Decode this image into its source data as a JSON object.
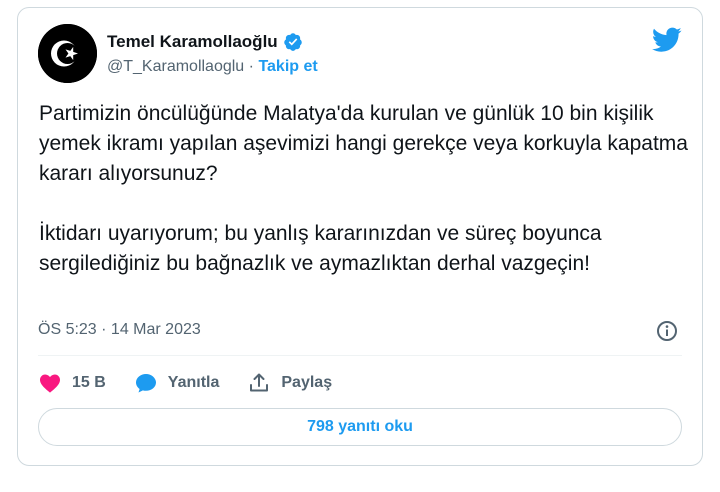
{
  "author": {
    "name": "Temel Karamollaoğlu",
    "handle": "@T_Karamollaoglu",
    "separator": "·",
    "follow_label": "Takip et",
    "avatar_icon": "crescent-star-icon",
    "verified_icon": "verified-badge-icon"
  },
  "tweet": {
    "text": "Partimizin öncülüğünde Malatya'da kurulan ve günlük 10 bin kişilik yemek ikramı yapılan aşevimizi hangi gerekçe veya korkuyla kapatma kararı alıyorsunuz?\n\nİktidarı uyarıyorum; bu yanlış kararınızdan ve süreç boyunca sergilediğiniz bu bağnazlık ve aymazlıktan derhal vazgeçin!",
    "timestamp": "ÖS 5:23 · 14 Mar 2023"
  },
  "actions": {
    "like_count": "15 B",
    "reply_label": "Yanıtla",
    "share_label": "Paylaş"
  },
  "replies_button": "798 yanıtı oku",
  "colors": {
    "accent": "#1d9bf0",
    "like": "#f91880",
    "text": "#0f1419",
    "muted": "#536471"
  }
}
